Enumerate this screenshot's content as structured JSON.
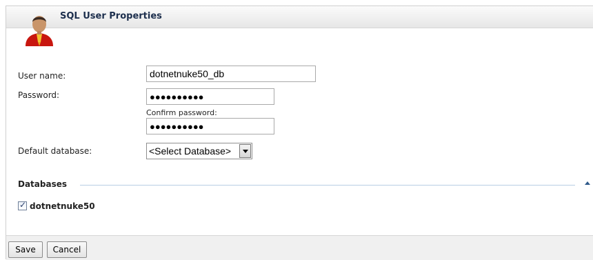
{
  "dialog": {
    "title": "SQL User Properties",
    "avatar_icon": "user-avatar-icon"
  },
  "form": {
    "username_label": "User name:",
    "username_value": "dotnetnuke50_db",
    "password_label": "Password:",
    "password_value": "●●●●●●●●●●",
    "confirm_label": "Confirm password:",
    "confirm_value": "●●●●●●●●●●",
    "default_db_label": "Default database:",
    "default_db_value": "<Select Database>"
  },
  "databases": {
    "section_title": "Databases",
    "items": [
      {
        "label": "dotnetnuke50",
        "checked": true
      }
    ]
  },
  "footer": {
    "save_label": "Save",
    "cancel_label": "Cancel"
  },
  "colors": {
    "title_text": "#1d2f4d",
    "section_line": "#b7cde3",
    "footer_bg": "#f0f0f0"
  }
}
